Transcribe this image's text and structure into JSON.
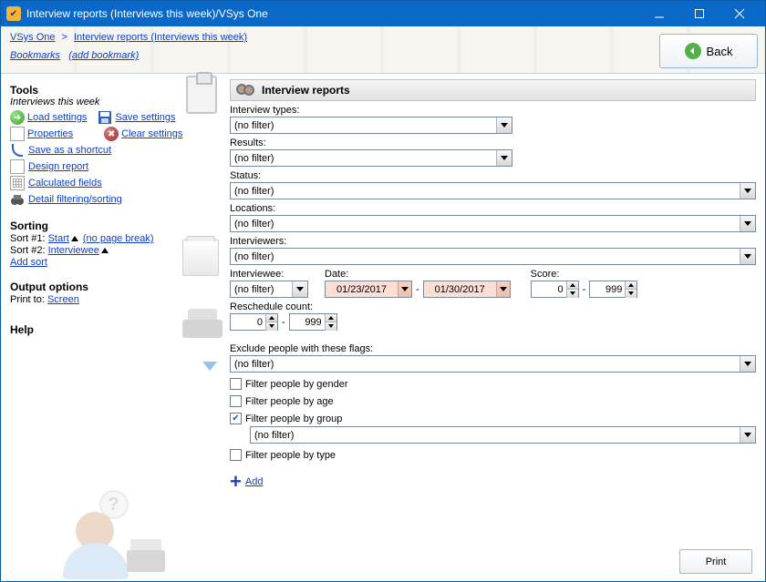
{
  "window": {
    "title": "Interview reports (Interviews this week)/VSys One"
  },
  "breadcrumb": {
    "root": "VSys One",
    "current": "Interview reports (Interviews this week)"
  },
  "bookmarks": {
    "label": "Bookmarks",
    "add": "(add bookmark)"
  },
  "back_label": "Back",
  "sidebar": {
    "tools_heading": "Tools",
    "subtitle": "Interviews this week",
    "load_settings": "Load settings",
    "save_settings": "Save settings",
    "properties": "Properties",
    "clear_settings": "Clear settings",
    "save_shortcut": "Save as a shortcut",
    "design_report": "Design report",
    "calculated_fields": "Calculated fields",
    "detail_filter": "Detail filtering/sorting",
    "sorting_heading": "Sorting",
    "sort1_label": "Sort #1: ",
    "sort1_link": "Start",
    "sort1_suffix": "(no page break)",
    "sort2_label": "Sort #2: ",
    "sort2_link": "Interviewee",
    "add_sort": "Add sort",
    "output_heading": "Output options",
    "print_to_label": "Print to: ",
    "print_to_value": "Screen",
    "help_heading": "Help"
  },
  "main": {
    "panel_title": "Interview reports",
    "interview_types_label": "Interview types:",
    "results_label": "Results:",
    "status_label": "Status:",
    "locations_label": "Locations:",
    "interviewers_label": "Interviewers:",
    "interviewee_label": "Interviewee:",
    "date_label": "Date:",
    "score_label": "Score:",
    "reschedule_label": "Reschedule count:",
    "exclude_label": "Exclude people with these flags:",
    "no_filter": "(no filter)",
    "date_from": "01/23/2017",
    "date_to": "01/30/2017",
    "score_from": "0",
    "score_to": "999",
    "resched_from": "0",
    "resched_to": "999",
    "chk_gender": "Filter people by gender",
    "chk_age": "Filter people by age",
    "chk_group": "Filter people by group",
    "chk_type": "Filter people by type",
    "add": "Add",
    "print": "Print"
  }
}
